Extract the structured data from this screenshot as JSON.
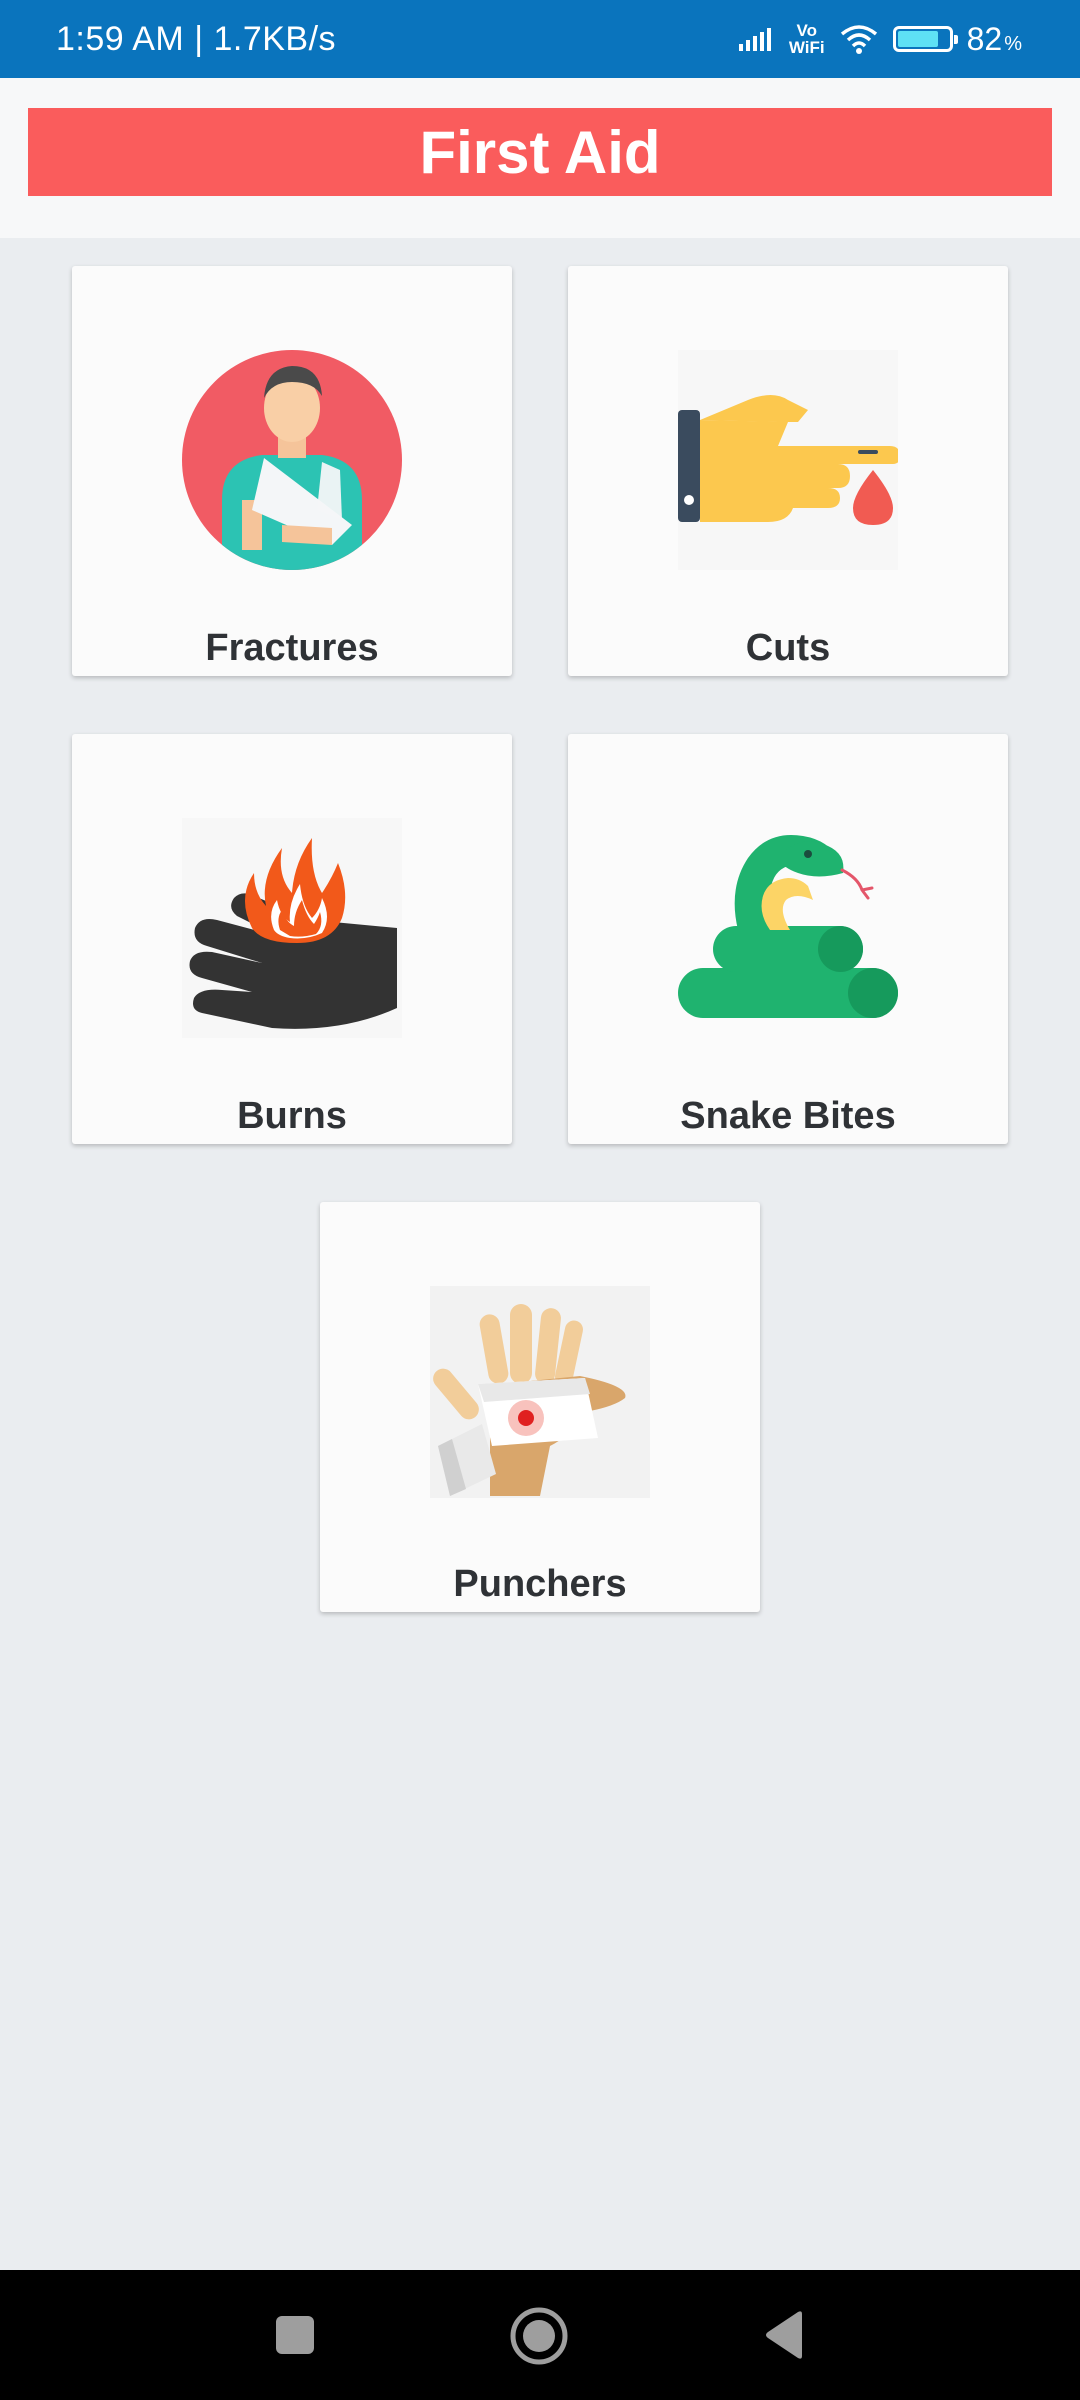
{
  "status_bar": {
    "time_speed": "1:59 AM | 1.7KB/s",
    "vowifi_top": "Vo",
    "vowifi_bottom": "WiFi",
    "battery_level": "82",
    "battery_unit": "%"
  },
  "header": {
    "title": "First Aid"
  },
  "cards": [
    {
      "label": "Fractures",
      "icon": "arm-sling-person-icon"
    },
    {
      "label": "Cuts",
      "icon": "bleeding-finger-icon"
    },
    {
      "label": "Burns",
      "icon": "burning-hand-icon"
    },
    {
      "label": "Snake Bites",
      "icon": "snake-icon"
    },
    {
      "label": "Punchers",
      "icon": "bandaged-hand-icon"
    }
  ],
  "nav_bar": {
    "buttons": [
      "recents-button",
      "home-button",
      "back-button"
    ]
  },
  "colors": {
    "status_bar": "#0a74bd",
    "title_bar": "#fa5c5c",
    "background": "#eaedf0",
    "card": "#fbfbfb"
  }
}
